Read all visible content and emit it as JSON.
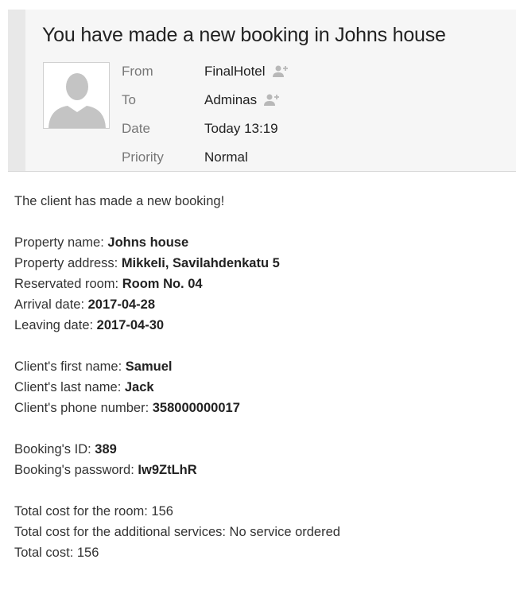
{
  "email": {
    "subject": "You have made a new booking in Johns house",
    "meta": {
      "from_label": "From",
      "from_value": "FinalHotel",
      "to_label": "To",
      "to_value": "Adminas",
      "date_label": "Date",
      "date_value": "Today 13:19",
      "priority_label": "Priority",
      "priority_value": "Normal"
    }
  },
  "body": {
    "intro": "The client has made a new booking!",
    "property_name_label": "Property name: ",
    "property_name": "Johns house",
    "property_address_label": "Property address: ",
    "property_address": "Mikkeli, Savilahdenkatu 5",
    "room_label": "Reservated room: ",
    "room": "Room No. 04",
    "arrival_label": "Arrival date: ",
    "arrival": "2017-04-28",
    "leaving_label": "Leaving date: ",
    "leaving": "2017-04-30",
    "first_name_label": "Client's first name: ",
    "first_name": "Samuel",
    "last_name_label": "Client's last name: ",
    "last_name": "Jack",
    "phone_label": "Client's phone number: ",
    "phone": "358000000017",
    "booking_id_label": "Booking's ID: ",
    "booking_id": "389",
    "password_label": "Booking's password: ",
    "password": "Iw9ZtLhR",
    "room_cost": "Total cost for the room: 156",
    "services_cost": "Total cost for the additional services: No service ordered",
    "total_cost": "Total cost: 156"
  },
  "colors": {
    "header_bg": "#f6f6f6",
    "header_accent": "#e8e8e8",
    "label_gray": "#777777",
    "text": "#333333"
  },
  "icons": [
    "avatar-placeholder-icon",
    "add-contact-icon"
  ]
}
